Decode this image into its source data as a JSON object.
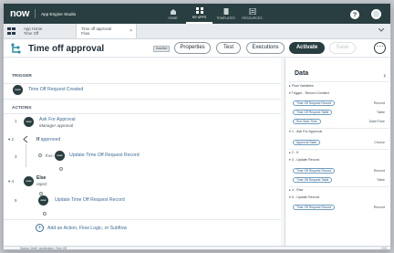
{
  "app": {
    "brand": "now",
    "studio": "App Engine Studio",
    "nav": [
      {
        "label": "HOME",
        "active": false
      },
      {
        "label": "MY APPS",
        "active": true
      },
      {
        "label": "TEMPLATES",
        "active": false
      },
      {
        "label": "RESOURCES",
        "active": false
      }
    ]
  },
  "tabs": [
    {
      "line1": "App Home",
      "line2": "Time Off"
    },
    {
      "line1": "Time off approval",
      "line2": "Flow"
    }
  ],
  "header": {
    "title": "Time off approval",
    "status": "Inactive",
    "buttons": {
      "properties": "Properties",
      "test": "Test",
      "executions": "Executions",
      "activate": "Activate",
      "save": "Save"
    }
  },
  "canvas": {
    "trigger_section": "TRIGGER",
    "trigger": "Time Off Request Created",
    "actions_section": "ACTIONS",
    "actions": [
      {
        "num": "1",
        "label": "Ask For Approval",
        "sub": "Manager approval"
      },
      {
        "num": "2",
        "label": "If",
        "sub": "approved"
      },
      {
        "num": "3",
        "then": "then",
        "label": "Update Time Off Request Record"
      },
      {
        "num": "4",
        "label": "Else",
        "sub": "reject"
      },
      {
        "num": "5",
        "label": "Update Time Off Request Record"
      }
    ],
    "add": "Add an Action, Flow Logic, or Subflow"
  },
  "status_bar": {
    "left": "Status: Draft",
    "app": "Application: Time Off",
    "right": "0 Q"
  },
  "data": {
    "title": "Data",
    "groups": [
      {
        "label": "▸ Flow Variables"
      },
      {
        "label": "▾ Trigger - Record Created"
      },
      {
        "pill": "Time Off Request Record",
        "type": "Record"
      },
      {
        "pill": "Time Off Request Table",
        "type": "Table"
      },
      {
        "pill": "Run Start Time",
        "type": "Date/Time"
      },
      {
        "label": "▾ 1 - Ask For Approval"
      },
      {
        "pill": "Approval State",
        "type": "Choice"
      },
      {
        "label": "▸ 2 - If"
      },
      {
        "label": "▾ 3 - Update Record"
      },
      {
        "pill": "Time Off Request Record",
        "type": "Record"
      },
      {
        "pill": "Time Off Request Table",
        "type": "Table"
      },
      {
        "label": "▸ 4 - Else"
      },
      {
        "label": "▾ 5 - Update Record"
      },
      {
        "pill": "Time Off Request Record",
        "type": "Record"
      }
    ]
  }
}
